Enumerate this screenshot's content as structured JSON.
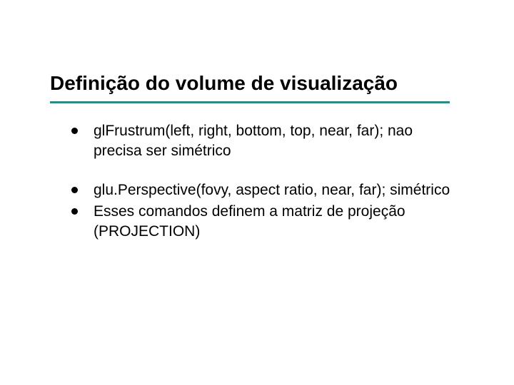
{
  "title": "Definição do volume de visualização",
  "groups": [
    {
      "items": [
        "glFrustrum(left, right, bottom, top, near, far); nao precisa ser simétrico"
      ]
    },
    {
      "items": [
        "glu.Perspective(fovy, aspect ratio, near, far); simétrico",
        "Esses comandos definem a matriz de projeção (PROJECTION)"
      ]
    }
  ]
}
